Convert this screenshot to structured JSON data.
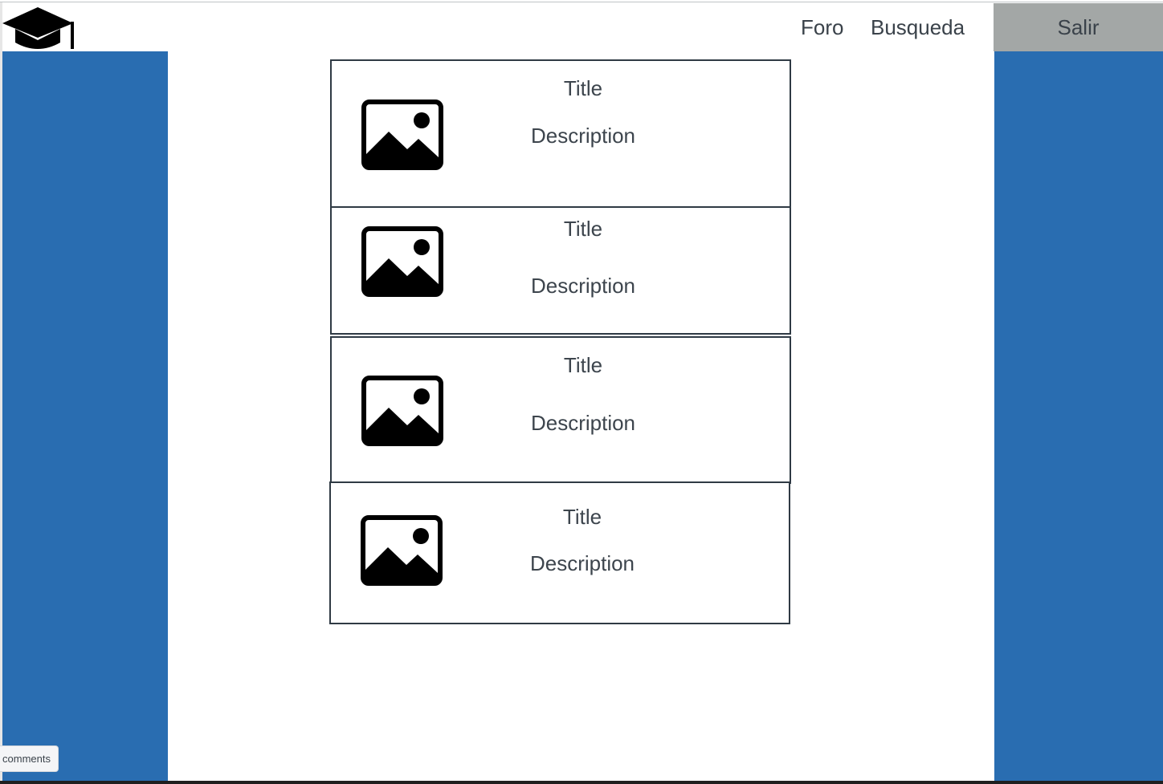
{
  "header": {
    "logo_icon": "graduation-cap-icon",
    "nav": [
      {
        "label": "Foro"
      },
      {
        "label": "Busqueda"
      }
    ],
    "logout_label": "Salir"
  },
  "cards": [
    {
      "title": "Title",
      "description": "Description",
      "icon": "image-placeholder-icon"
    },
    {
      "title": "Title",
      "description": "Description",
      "icon": "image-placeholder-icon"
    },
    {
      "title": "Title",
      "description": "Description",
      "icon": "image-placeholder-icon"
    },
    {
      "title": "Title",
      "description": "Description",
      "icon": "image-placeholder-icon"
    }
  ],
  "comments_tab": {
    "label": "comments"
  },
  "colors": {
    "sidebar": "#296db1",
    "logout_button": "#a3a7a6",
    "card_border": "#2f3a44",
    "text": "#3a424a"
  }
}
